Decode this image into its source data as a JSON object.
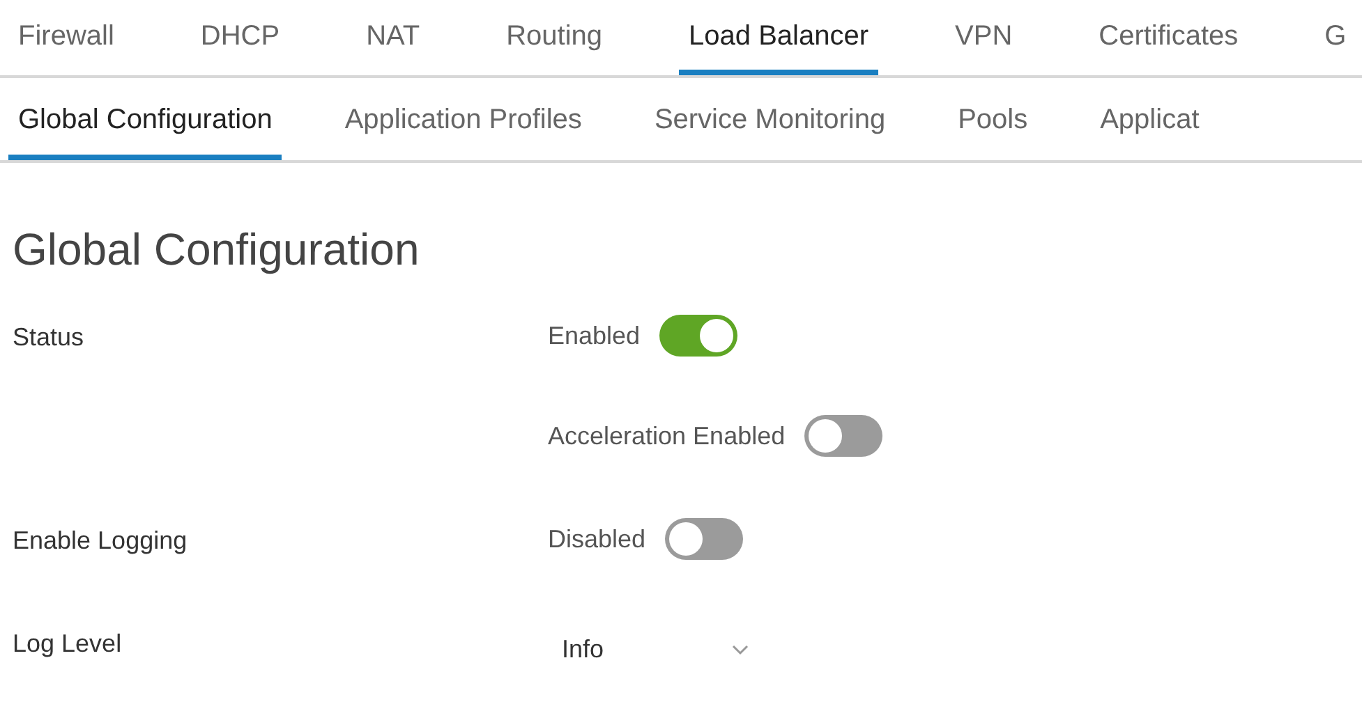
{
  "tabs": [
    {
      "label": "Firewall",
      "selected": false
    },
    {
      "label": "DHCP",
      "selected": false
    },
    {
      "label": "NAT",
      "selected": false
    },
    {
      "label": "Routing",
      "selected": false
    },
    {
      "label": "Load Balancer",
      "selected": true
    },
    {
      "label": "VPN",
      "selected": false
    },
    {
      "label": "Certificates",
      "selected": false
    },
    {
      "label": "G",
      "selected": false
    }
  ],
  "subtabs": [
    {
      "label": "Global Configuration",
      "selected": true
    },
    {
      "label": "Application Profiles",
      "selected": false
    },
    {
      "label": "Service Monitoring",
      "selected": false
    },
    {
      "label": "Pools",
      "selected": false
    },
    {
      "label": "Applicat",
      "selected": false
    }
  ],
  "heading": "Global Configuration",
  "settings": [
    {
      "label": "Status",
      "options": [
        {
          "kind": "toggle",
          "label": "Enabled",
          "on": true
        },
        {
          "kind": "toggle",
          "label": "Acceleration Enabled",
          "on": false
        }
      ]
    },
    {
      "label": "Enable Logging",
      "options": [
        {
          "kind": "toggle",
          "label": "Disabled",
          "on": false
        }
      ]
    },
    {
      "label": "Log Level",
      "options": [
        {
          "kind": "select",
          "value": "Info"
        }
      ]
    }
  ]
}
